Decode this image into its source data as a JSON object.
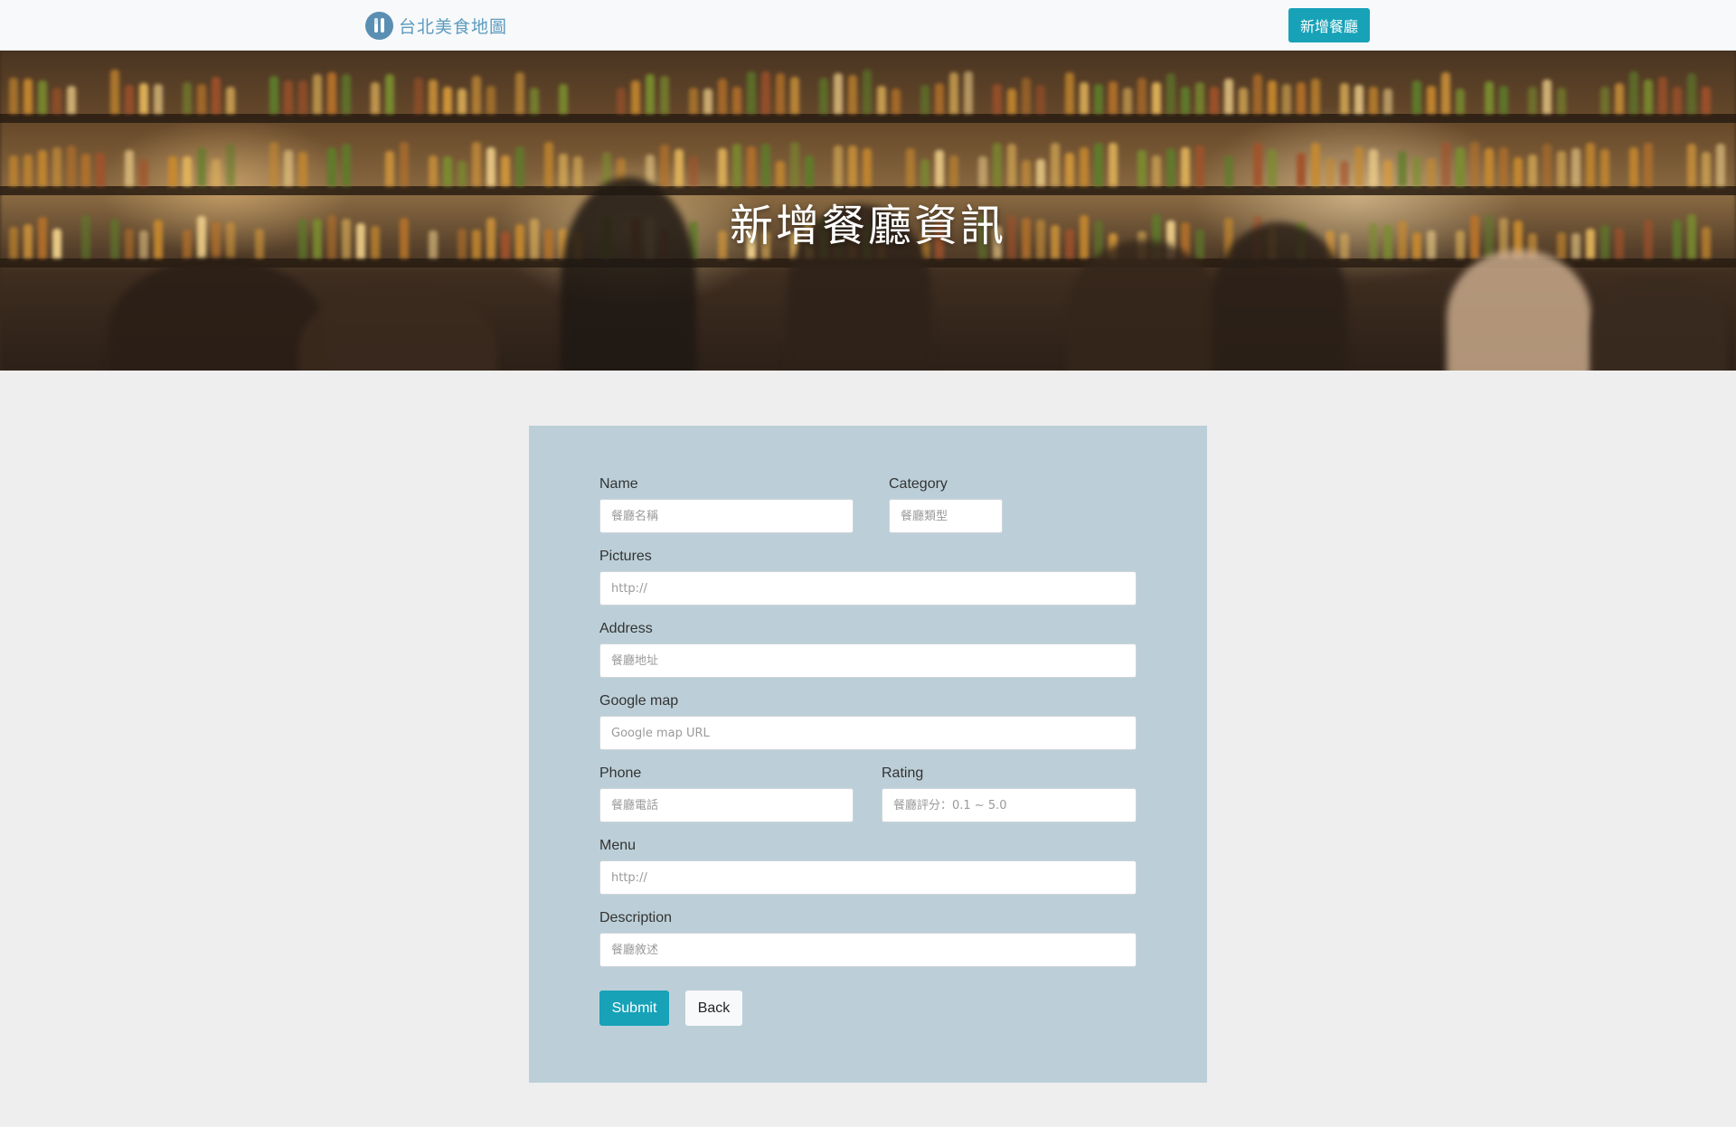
{
  "navbar": {
    "brand_text": "台北美食地圖",
    "brand_icon": "utensils-icon",
    "add_button_label": "新增餐廳"
  },
  "banner": {
    "title": "新增餐廳資訊"
  },
  "form": {
    "fields": {
      "name": {
        "label": "Name",
        "placeholder": "餐廳名稱"
      },
      "category": {
        "label": "Category",
        "placeholder": "餐廳類型"
      },
      "pictures": {
        "label": "Pictures",
        "placeholder": "http://"
      },
      "address": {
        "label": "Address",
        "placeholder": "餐廳地址"
      },
      "google_map": {
        "label": "Google map",
        "placeholder": "Google map URL"
      },
      "phone": {
        "label": "Phone",
        "placeholder": "餐廳電話"
      },
      "rating": {
        "label": "Rating",
        "placeholder": "餐廳評分：0.1 ~ 5.0"
      },
      "menu": {
        "label": "Menu",
        "placeholder": "http://"
      },
      "description": {
        "label": "Description",
        "placeholder": "餐廳敘述"
      }
    },
    "submit_label": "Submit",
    "back_label": "Back"
  },
  "colors": {
    "accent": "#17a2b8",
    "card_background": "#bccfd8",
    "page_background": "#eeeeee",
    "brand": "#5b9bbf"
  }
}
